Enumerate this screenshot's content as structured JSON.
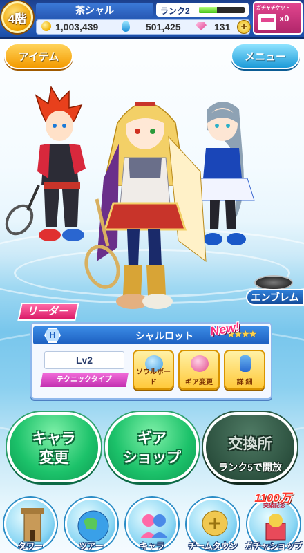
{
  "status": {
    "floor": "4階",
    "player_name": "茶シャル",
    "rank_label": "ランク2",
    "rank_progress": 0.4,
    "coins": "1,003,439",
    "drops": "501,425",
    "gems": "131",
    "ticket_label": "ガチャチケット",
    "ticket_count": "x0"
  },
  "buttons": {
    "item": "アイテム",
    "menu": "メニュー",
    "emblem": "エンブレム"
  },
  "leader": {
    "tag": "リーダー",
    "badge": "H",
    "name": "シャルロット",
    "stars": "★★★★",
    "level": "Lv2",
    "type": "テクニックタイプ",
    "new_badge": "New!",
    "actions": [
      "ソウルボード",
      "ギア変更",
      "詳 細"
    ]
  },
  "main": {
    "chara_change": [
      "キャラ",
      "変更"
    ],
    "gear_shop": [
      "ギア",
      "ショップ"
    ],
    "exchange": "交換所",
    "exchange_unlock": "ランク5で開放"
  },
  "nav": {
    "items": [
      "タワー",
      "ツアー",
      "キャラ",
      "チームタウン",
      "ガチャショップ"
    ],
    "anniversary": "1100万",
    "anniversary_sub": "突破記念"
  },
  "colors": {
    "green_button": "#1cc26a",
    "locked_button": "#2d5240",
    "top_bar": "#2a63c2",
    "leader_tag": "#d91866"
  }
}
